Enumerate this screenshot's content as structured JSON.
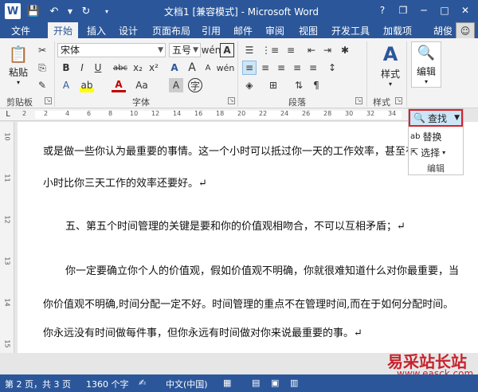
{
  "title": "文档1 [兼容模式] - Microsoft Word",
  "window": {
    "help": "?",
    "restore": "❐",
    "minimize": "─",
    "maximize": "□",
    "close": "✕"
  },
  "tabs": [
    "文件",
    "开始",
    "插入",
    "设计",
    "页面布局",
    "引用",
    "邮件",
    "审阅",
    "视图",
    "开发工具",
    "加载项"
  ],
  "user": "胡俊",
  "clipboard": {
    "paste": "粘贴",
    "label": "剪贴板"
  },
  "font": {
    "name": "宋体",
    "size": "五号",
    "label": "字体",
    "bold": "B",
    "italic": "I",
    "underline": "U",
    "strike": "abc",
    "sub": "x₂",
    "sup": "x²",
    "grow": "A",
    "shrink": "A",
    "case": "Aa",
    "color": "A"
  },
  "paragraph": {
    "label": "段落"
  },
  "styles": {
    "label": "样式",
    "button": "样式"
  },
  "editing": {
    "button": "编辑",
    "find": "查找",
    "replace": "替换",
    "select": "选择",
    "group_label": "编辑"
  },
  "ruler_ticks": [
    "2",
    "2",
    "4",
    "6",
    "8",
    "10",
    "12",
    "14",
    "16",
    "18",
    "20",
    "22",
    "24",
    "26",
    "28",
    "30",
    "32",
    "34"
  ],
  "vruler_ticks": [
    "10",
    "11",
    "12",
    "13",
    "14",
    "15"
  ],
  "document": {
    "lines": [
      "或是做一些你认为最重要的事情。这一个小时可以抵过你一天的工作效率，甚至有",
      "小时比你三天工作的效率还要好。↵",
      "五、第五个时间管理的关键是要和你的价值观相吻合，不可以互相矛盾；↵",
      "你一定要确立你个人的价值观，假如价值观不明确，你就很难知道什么对你最重要，当",
      "你价值观不明确,时间分配一定不好。时间管理的重点不在管理时间,而在于如何分配时间。",
      "你永远没有时间做每件事，但你永远有时间做对你来说最重要的事。↵"
    ]
  },
  "status": {
    "page": "第 2 页，共 3 页",
    "words": "1360 个字",
    "lang": "中文(中国)"
  },
  "watermark": {
    "site": "易采站长站",
    "url": "www.easck.com"
  }
}
